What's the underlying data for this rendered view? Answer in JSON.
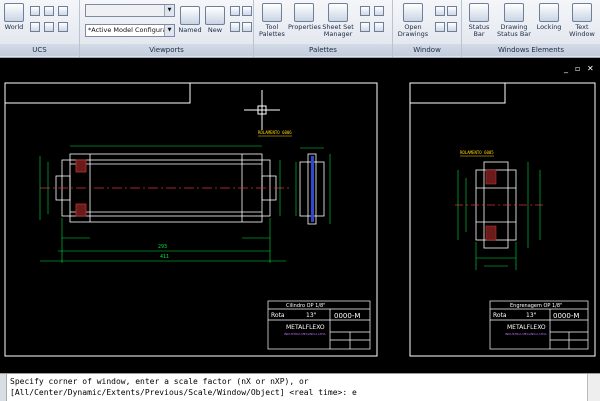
{
  "ribbon": {
    "ucs": {
      "title": "UCS",
      "world_label": "World"
    },
    "viewports": {
      "title": "Viewports",
      "config_value": "*Active Model Configuration",
      "named_label": "Named",
      "new_label": "New"
    },
    "palettes": {
      "title": "Palettes",
      "tool_palettes_label": "Tool Palettes",
      "properties_label": "Properties",
      "sheet_set_manager_label": "Sheet Set Manager"
    },
    "window": {
      "title": "Window",
      "open_drawings_label": "Open Drawings"
    },
    "windows_elements": {
      "title": "Windows Elements",
      "status_bar_label": "Status Bar",
      "drawing_status_bar_label": "Drawing Status Bar",
      "locking_label": "Locking",
      "text_window_label": "Text Window"
    }
  },
  "viewport_controls": {
    "minimize": "_",
    "restore": "▫",
    "close": "✕"
  },
  "drawing": {
    "left_sheet": {
      "view_title": "ROLAMENTO 6006",
      "dim_overall": "411",
      "dim_inner": "293",
      "title_block": {
        "part_name": "Cilindro OP 1/8\"",
        "rota_label": "Rota",
        "rota_value": "13\"",
        "drawing_number": "0000-M",
        "company": "METALFLEXO",
        "company_sub": "INDUSTRIA MECANICA LTDA"
      }
    },
    "right_sheet": {
      "view_title": "ROLAMENTO 6005",
      "title_block": {
        "part_name": "Engrenagem OP 1/8\"",
        "rota_label": "Rota",
        "rota_value": "13\"",
        "drawing_number": "0000-M",
        "company": "METALFLEXO",
        "company_sub": "INDUSTRIA MECANICA LTDA"
      }
    }
  },
  "command_line": {
    "line1": "Specify corner of window, enter a scale factor (nX or nXP), or",
    "line2": "[All/Center/Dynamic/Extents/Previous/Scale/Window/Object] <real time>: e"
  }
}
